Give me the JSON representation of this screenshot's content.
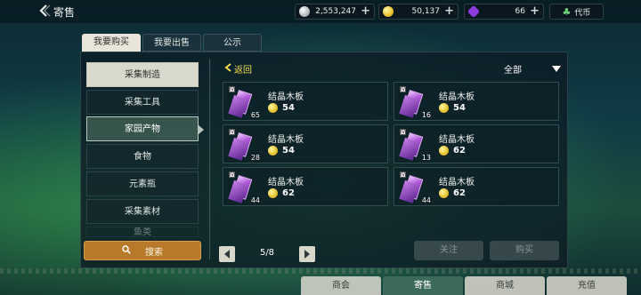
{
  "header": {
    "title": "寄售",
    "silver": "2,553,247",
    "gold": "50,137",
    "gems": "66",
    "token_label": "代币"
  },
  "tabs": [
    {
      "label": "我要购买",
      "active": true
    },
    {
      "label": "我要出售",
      "active": false
    },
    {
      "label": "公示",
      "active": false
    }
  ],
  "categories": [
    {
      "label": "采集制造",
      "type": "header"
    },
    {
      "label": "采集工具",
      "type": "normal"
    },
    {
      "label": "家园产物",
      "type": "selected"
    },
    {
      "label": "食物",
      "type": "normal"
    },
    {
      "label": "元素瓶",
      "type": "normal"
    },
    {
      "label": "采集素材",
      "type": "normal"
    },
    {
      "label": "鱼类",
      "type": "faded"
    }
  ],
  "search_label": "搜索",
  "return_label": "返回",
  "filter_label": "全部",
  "items": [
    {
      "name": "结晶木板",
      "qty": "65",
      "price": "54",
      "tier": "IV"
    },
    {
      "name": "结晶木板",
      "qty": "16",
      "price": "54",
      "tier": "IV"
    },
    {
      "name": "结晶木板",
      "qty": "28",
      "price": "54",
      "tier": "IV"
    },
    {
      "name": "结晶木板",
      "qty": "13",
      "price": "62",
      "tier": "IV"
    },
    {
      "name": "结晶木板",
      "qty": "44",
      "price": "62",
      "tier": "IV"
    },
    {
      "name": "结晶木板",
      "qty": "44",
      "price": "62",
      "tier": "IV"
    }
  ],
  "pager": {
    "text": "5/8"
  },
  "actions": {
    "follow": "关注",
    "buy": "购买"
  },
  "bottom_nav": [
    {
      "label": "商会",
      "active": false
    },
    {
      "label": "寄售",
      "active": true
    },
    {
      "label": "商城",
      "active": false
    },
    {
      "label": "充值",
      "active": false
    }
  ],
  "colors": {
    "accent_gold": "#f4dd4d",
    "search_button": "#b87a2a",
    "item_crystal": "#b15ad9"
  }
}
